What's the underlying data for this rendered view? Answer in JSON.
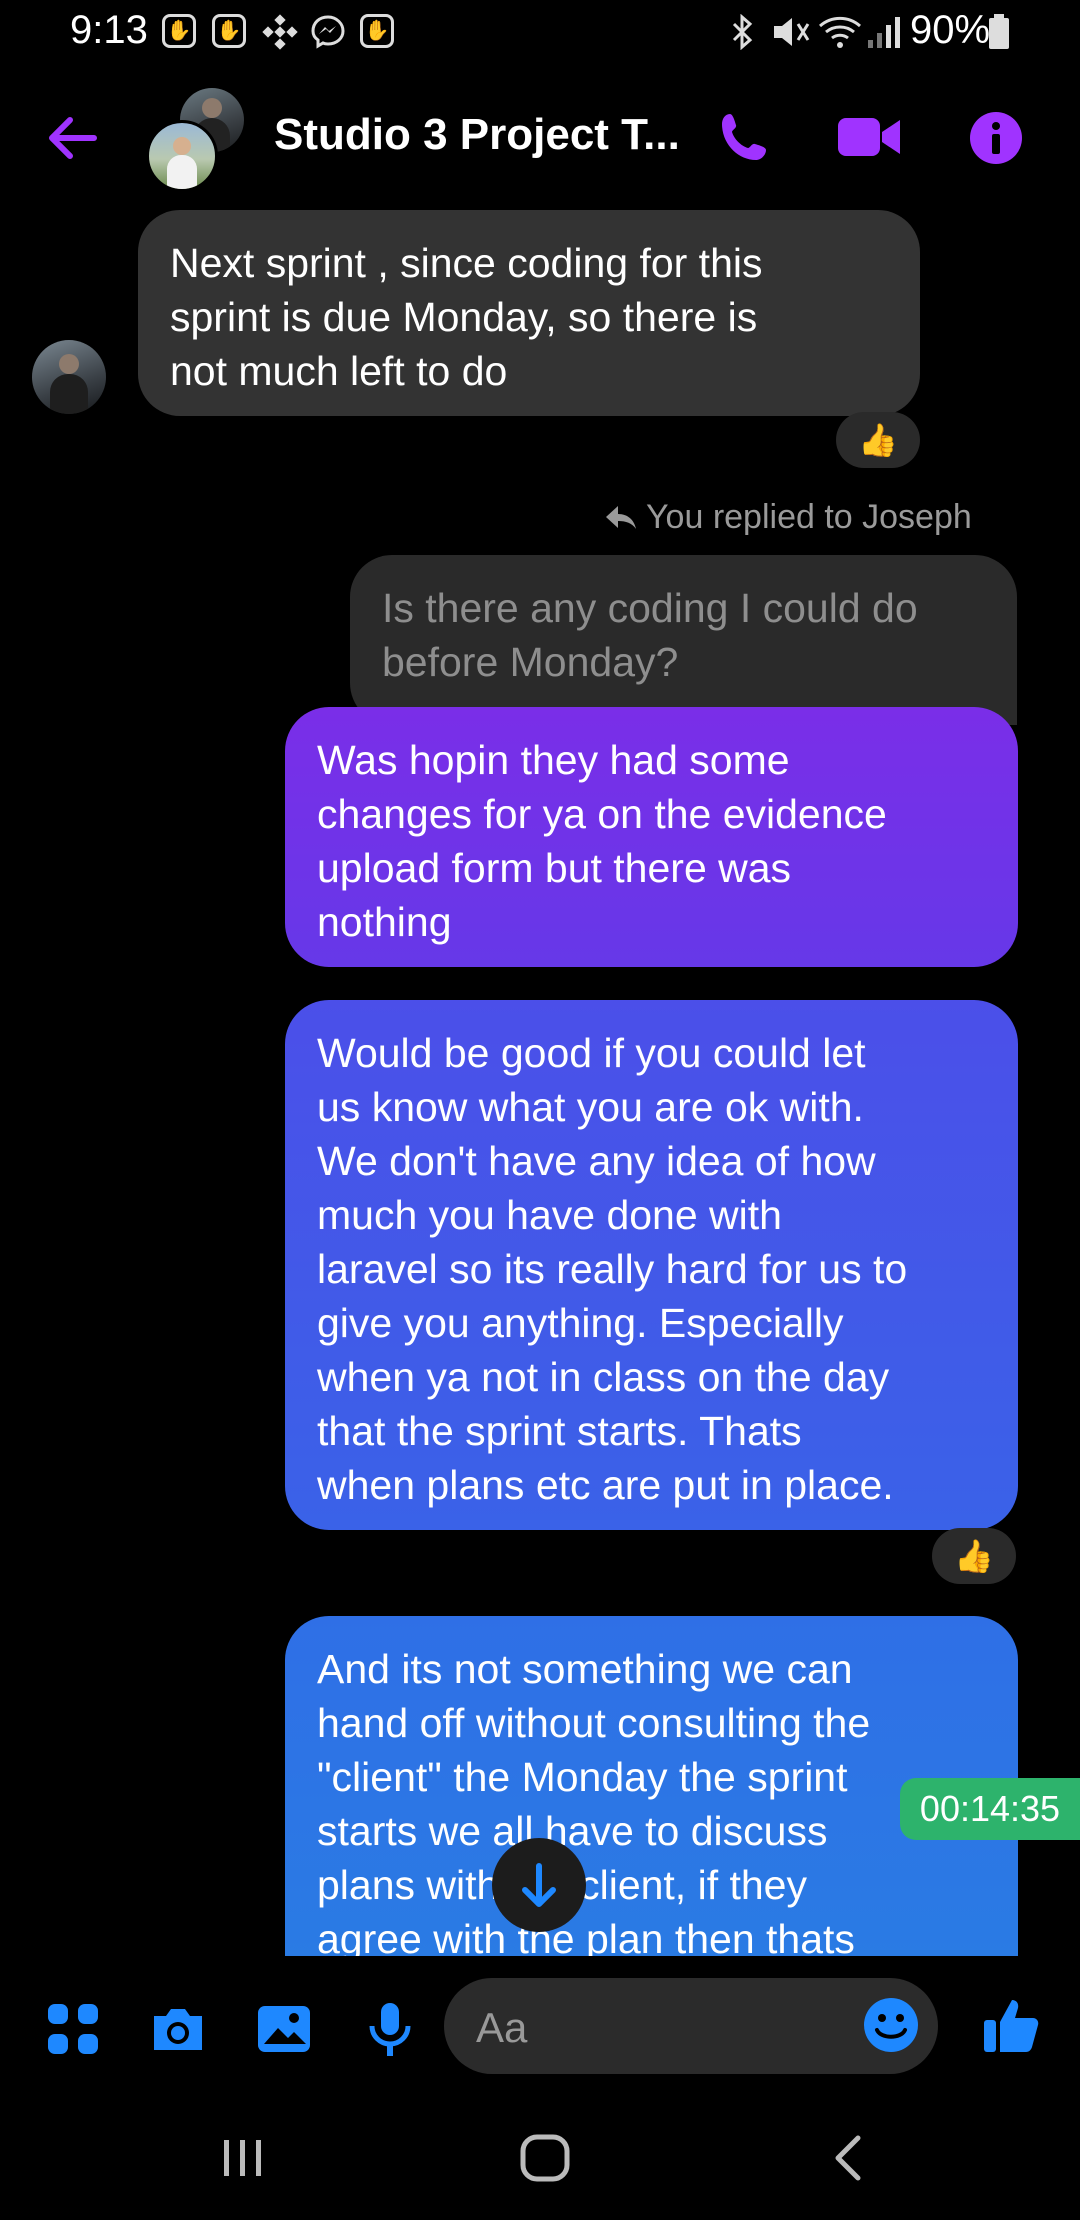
{
  "status_bar": {
    "time": "9:13",
    "battery": "90%",
    "notification_icons": [
      "hand-icon",
      "hand-icon",
      "binance-icon",
      "messenger-icon",
      "hand-icon"
    ]
  },
  "header": {
    "title": "Studio 3 Project T...",
    "accent_color": "#a033ff"
  },
  "messages": {
    "incoming_text": "Next sprint , since coding for this\nsprint is due Monday, so there is\nnot much left to do",
    "incoming_reaction": "👍",
    "reply_label": "You replied to Joseph",
    "quoted_text": "Is there any coding I could do\nbefore Monday?",
    "out_1": "Was hopin they had some\nchanges for ya on the evidence\nupload form but there was\nnothing",
    "out_2": "Would be good if you could let\nus know what you are ok with.\nWe don't have any idea of how\nmuch you have done with\nlaravel so its really hard for us to\ngive you anything. Especially\nwhen ya not in class on the day\nthat the sprint starts. Thats\nwhen plans etc are put in place.",
    "out_2_reaction": "👍",
    "out_3": "And its not something we can\nhand off without consulting the\n\"client\" the Monday the sprint\nstarts we all have to discuss\nplans with the client, if they\nagree with the plan then thats"
  },
  "overlay": {
    "timer": "00:14:35"
  },
  "composer": {
    "placeholder": "Aa",
    "accent_color": "#1e88ff"
  }
}
